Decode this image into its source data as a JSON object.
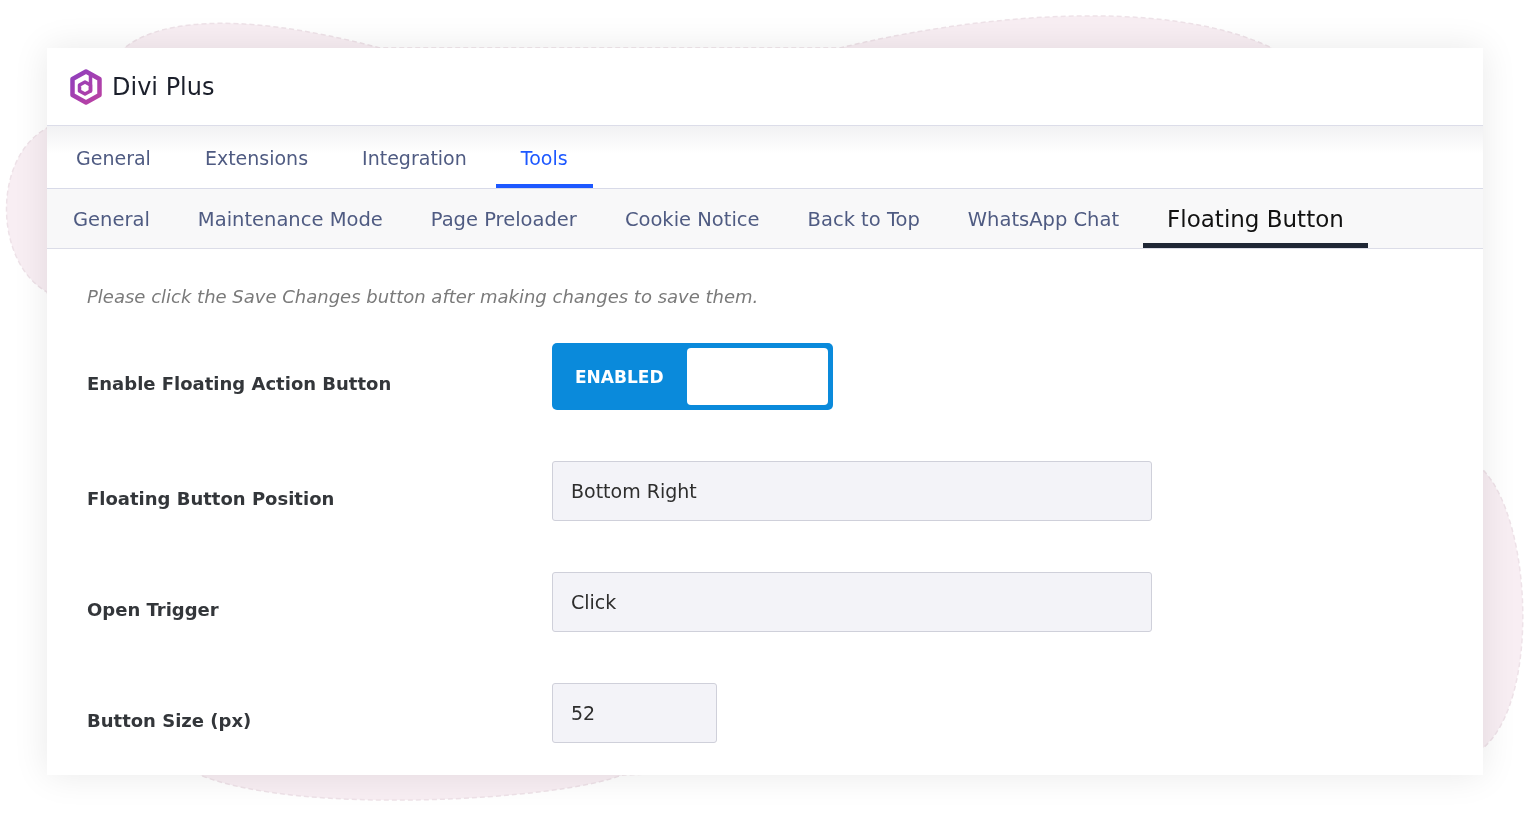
{
  "app": {
    "title": "Divi Plus"
  },
  "main_tabs": [
    {
      "label": "General",
      "selected": false
    },
    {
      "label": "Extensions",
      "selected": false
    },
    {
      "label": "Integration",
      "selected": false
    },
    {
      "label": "Tools",
      "selected": true
    }
  ],
  "sub_tabs": [
    {
      "label": "General",
      "selected": false
    },
    {
      "label": "Maintenance Mode",
      "selected": false
    },
    {
      "label": "Page Preloader",
      "selected": false
    },
    {
      "label": "Cookie Notice",
      "selected": false
    },
    {
      "label": "Back to Top",
      "selected": false
    },
    {
      "label": "WhatsApp Chat",
      "selected": false
    },
    {
      "label": "Floating Button",
      "selected": true
    }
  ],
  "notice": "Please click the Save Changes button after making changes to save them.",
  "settings": [
    {
      "kind": "toggle",
      "label": "Enable Floating Action Button",
      "on": true,
      "state_text": "ENABLED"
    },
    {
      "kind": "text",
      "label": "Floating Button Position",
      "value": "Bottom Right"
    },
    {
      "kind": "text",
      "label": "Open Trigger",
      "value": "Click"
    },
    {
      "kind": "number",
      "label": "Button Size (px)",
      "value": "52"
    }
  ]
}
